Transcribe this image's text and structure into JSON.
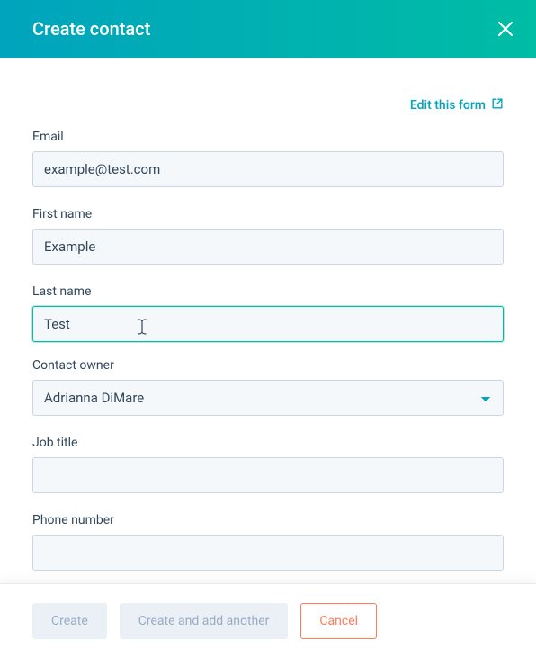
{
  "header": {
    "title": "Create contact"
  },
  "editLink": {
    "label": "Edit this form"
  },
  "fields": {
    "email": {
      "label": "Email",
      "value": "example@test.com"
    },
    "firstName": {
      "label": "First name",
      "value": "Example"
    },
    "lastName": {
      "label": "Last name",
      "value": "Test"
    },
    "contactOwner": {
      "label": "Contact owner",
      "value": "Adrianna DiMare"
    },
    "jobTitle": {
      "label": "Job title",
      "value": ""
    },
    "phoneNumber": {
      "label": "Phone number",
      "value": ""
    }
  },
  "footer": {
    "create": "Create",
    "createAnother": "Create and add another",
    "cancel": "Cancel"
  },
  "colors": {
    "accent": "#00a4bd",
    "accentGradientEnd": "#00bda5",
    "coral": "#ff7a59"
  }
}
